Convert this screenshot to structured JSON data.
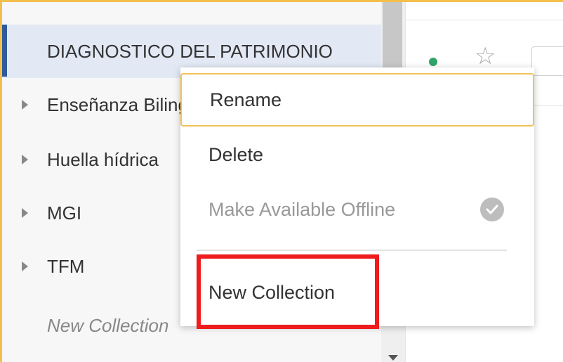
{
  "sidebar": {
    "items": [
      {
        "label": "DIAGNOSTICO DEL PATRIMONIO",
        "expandable": false,
        "selected": true
      },
      {
        "label": "Enseñanza Bilingüe",
        "expandable": true,
        "selected": false
      },
      {
        "label": "Huella hídrica",
        "expandable": true,
        "selected": false
      },
      {
        "label": "MGI",
        "expandable": true,
        "selected": false
      },
      {
        "label": "TFM",
        "expandable": true,
        "selected": false
      }
    ],
    "new_collection_label": "New Collection"
  },
  "context_menu": {
    "rename_label": "Rename",
    "delete_label": "Delete",
    "offline_label": "Make Available Offline",
    "new_collection_label": "New Collection"
  },
  "colors": {
    "frame_border": "#f3c04d",
    "selected_indicator": "#2f5a9b",
    "highlight_box": "#ee1c1c",
    "status_dot": "#2fa56a"
  }
}
